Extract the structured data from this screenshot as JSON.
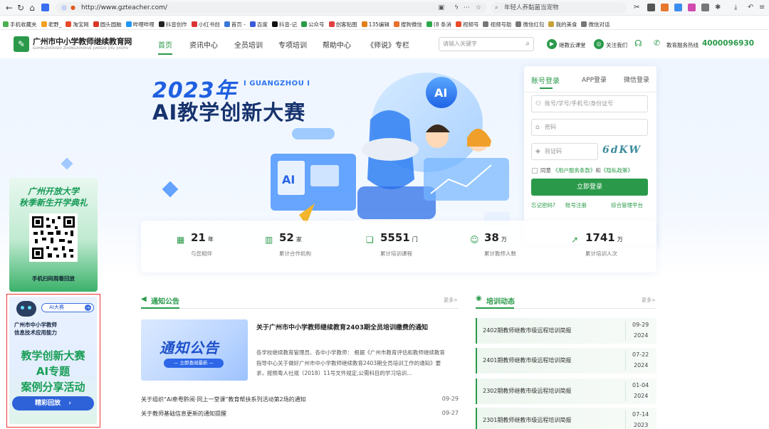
{
  "browser": {
    "url": "http://www.gzteacher.com/",
    "search_text": "年轻人养黏菌当宠物",
    "bookmarks": [
      "手机收藏夹",
      "老野_",
      "淘宝网",
      "圆头圆脑",
      "哔哩哔哩",
      "抖音创作",
      "小红书创",
      "首页 -",
      "百度",
      "抖音-记",
      "公众号",
      "创客贴图",
      "135编辑",
      "搜狗微信",
      "(8 条消",
      "视频号",
      "视频号助",
      "微信红包",
      "我的美食",
      "微信对话"
    ]
  },
  "header": {
    "logo_title": "广州市中小学教师继续教育网",
    "logo_subtitle": "GUANGZHOUSHI ZHONGXIAOXUE JIAOSHI JIXU JIAOYU",
    "nav": [
      "首页",
      "资讯中心",
      "全员培训",
      "专项培训",
      "帮助中心",
      "《师说》专栏"
    ],
    "search_placeholder": "请输入关键字",
    "links": [
      "继教云课堂",
      "关注我们"
    ],
    "hotline_label": "教育服务热线",
    "hotline_number": "4000096930"
  },
  "hero": {
    "year": "2023年",
    "location": "I GUANGZHOU I",
    "title": "AI教学创新大赛"
  },
  "login": {
    "tabs": [
      "账号登录",
      "APP登录",
      "微信登录"
    ],
    "account_placeholder": "账号/学号/手机号/身份证号",
    "password_placeholder": "密码",
    "captcha_placeholder": "验证码",
    "captcha_image": "6dKW",
    "agree_prefix": "同意",
    "terms": "《用户服务条款》",
    "and": "和",
    "privacy": "《隐私政策》",
    "login_button": "立即登录",
    "forgot": "忘记密码?",
    "register": "账号注册",
    "admin": "综合管理平台"
  },
  "stats": [
    {
      "value": "21",
      "unit": "年",
      "label": "与您相伴"
    },
    {
      "value": "52",
      "unit": "家",
      "label": "累计合作机构"
    },
    {
      "value": "5551",
      "unit": "门",
      "label": "累计培训课程"
    },
    {
      "value": "38",
      "unit": "万",
      "label": "累计教师人数"
    },
    {
      "value": "1741",
      "unit": "万",
      "label": "累计培训人次"
    }
  ],
  "notices": {
    "title": "通知公告",
    "more": "更多>",
    "image_title": "通知公告",
    "image_sub": "— 立即查阅最新 —",
    "headline": "关于广州市中小学教师继续教育2403期全员培训缴费的通知",
    "excerpt": "各学校继续教育管理员、各中小学教师： 根据《广州市教育评估和教师继续教育指导中心关于做好广州市中小学教师继续教育2403期全员培训工作的通知》要求，按照粤人社规〔2018〕11号文件规定,公需科目的学习培训…",
    "items": [
      {
        "title": "关于组织“Ai牵粤黔阅·同上一堂课”教育帮扶系列活动第2场的通知",
        "date": "09-29"
      },
      {
        "title": "关于教师基础信息更新的通知提醒",
        "date": "09-27"
      }
    ]
  },
  "training": {
    "title": "培训动态",
    "more": "更多>",
    "items": [
      {
        "title": "2402期教师继教市级远程培训简报",
        "date": "09-29",
        "year": "2024"
      },
      {
        "title": "2401期教师继教市级远程培训简报",
        "date": "07-22",
        "year": "2024"
      },
      {
        "title": "2302期教师继教市级远程培训简报",
        "date": "01-04",
        "year": "2024"
      },
      {
        "title": "2301期教师继教市级远程培训简报",
        "date": "07-14",
        "year": "2023"
      }
    ]
  },
  "banner_ou": {
    "line1": "广州开放大学",
    "line2": "秋季新生开学典礼",
    "caption": "手机扫码观看回放"
  },
  "banner_ai": {
    "pill": "AI大赛",
    "sub1": "广州市中小学教师",
    "sub2": "信息技术应用能力",
    "line1": "教学创新大赛",
    "line2": "AI专题",
    "line3": "案例分享活动",
    "button": "精彩回放"
  }
}
